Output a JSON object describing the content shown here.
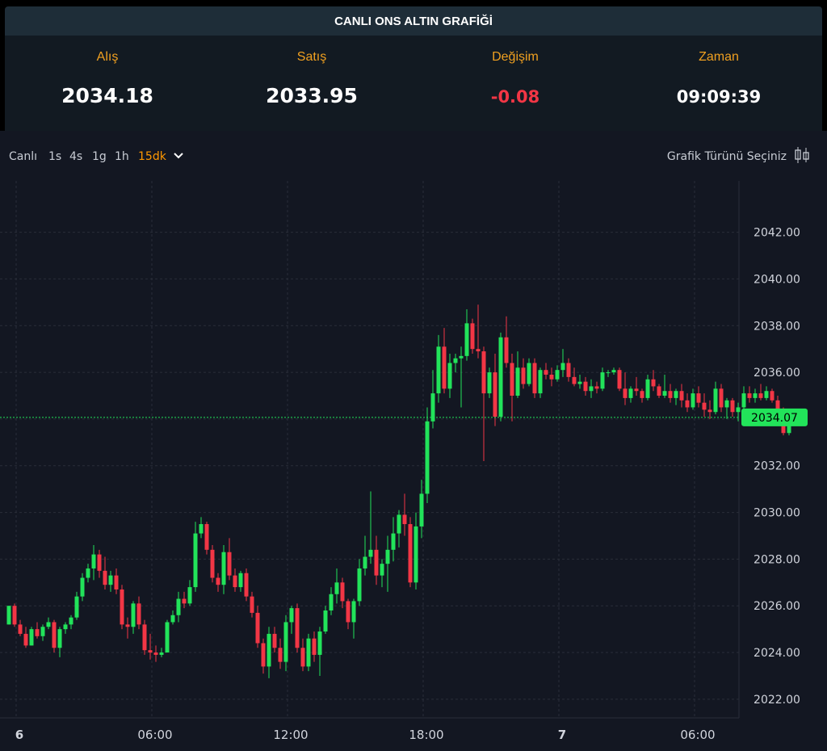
{
  "header": {
    "title": "CANLI ONS ALTIN GRAFİĞİ"
  },
  "quote": {
    "bid_label": "Alış",
    "bid_value": "2034.18",
    "ask_label": "Satış",
    "ask_value": "2033.95",
    "change_label": "Değişim",
    "change_value": "-0.08",
    "time_label": "Zaman",
    "time_value": "09:09:39"
  },
  "toolbar": {
    "timeframes": [
      "Canlı",
      "1s",
      "4s",
      "1g",
      "1h",
      "15dk"
    ],
    "active_timeframe": "15dk",
    "chart_type_label": "Grafik Türünü Seçiniz"
  },
  "colors": {
    "up": "#22e35a",
    "down": "#f23645",
    "accent": "#ff9800",
    "last_price": "#22e35a"
  },
  "chart_data": {
    "type": "candlestick",
    "title": "",
    "ylim": [
      2021.2,
      2044.2
    ],
    "y_ticks": [
      "2022.00",
      "2024.00",
      "2026.00",
      "2028.00",
      "2030.00",
      "2032.00",
      "2034.00",
      "2036.00",
      "2038.00",
      "2040.00",
      "2042.00"
    ],
    "x_ticks": [
      {
        "label": "6",
        "hour": 0
      },
      {
        "label": "06:00",
        "hour": 6
      },
      {
        "label": "12:00",
        "hour": 12
      },
      {
        "label": "18:00",
        "hour": 18
      },
      {
        "label": "7",
        "hour": 24
      },
      {
        "label": "06:00",
        "hour": 30
      }
    ],
    "grid": true,
    "last_price": "2034.07",
    "candles": [
      [
        2025.2,
        2026.0,
        2025.2,
        2026.0
      ],
      [
        2026.0,
        2026.1,
        2025.1,
        2025.2
      ],
      [
        2025.2,
        2025.4,
        2024.7,
        2024.8
      ],
      [
        2024.8,
        2025.1,
        2024.2,
        2024.3
      ],
      [
        2024.3,
        2025.1,
        2024.3,
        2025.0
      ],
      [
        2025.0,
        2025.3,
        2024.6,
        2024.7
      ],
      [
        2024.7,
        2025.2,
        2024.5,
        2025.1
      ],
      [
        2025.1,
        2025.5,
        2025.0,
        2025.3
      ],
      [
        2025.3,
        2025.4,
        2024.0,
        2024.2
      ],
      [
        2024.2,
        2025.1,
        2023.8,
        2025.0
      ],
      [
        2025.0,
        2025.3,
        2024.8,
        2025.2
      ],
      [
        2025.2,
        2025.6,
        2025.0,
        2025.5
      ],
      [
        2025.5,
        2026.6,
        2025.4,
        2026.4
      ],
      [
        2026.4,
        2027.4,
        2026.2,
        2027.2
      ],
      [
        2027.2,
        2027.8,
        2027.0,
        2027.6
      ],
      [
        2027.6,
        2028.6,
        2027.1,
        2028.2
      ],
      [
        2028.2,
        2028.4,
        2027.2,
        2027.5
      ],
      [
        2027.5,
        2028.1,
        2026.7,
        2026.9
      ],
      [
        2026.9,
        2027.5,
        2026.6,
        2027.3
      ],
      [
        2027.3,
        2027.6,
        2026.5,
        2026.7
      ],
      [
        2026.7,
        2026.9,
        2025.0,
        2025.2
      ],
      [
        2025.2,
        2025.5,
        2024.6,
        2025.1
      ],
      [
        2025.1,
        2026.2,
        2024.8,
        2026.1
      ],
      [
        2026.1,
        2026.4,
        2025.0,
        2025.2
      ],
      [
        2025.2,
        2025.4,
        2023.9,
        2024.1
      ],
      [
        2024.1,
        2024.8,
        2023.7,
        2024.0
      ],
      [
        2024.0,
        2024.3,
        2023.6,
        2023.9
      ],
      [
        2023.9,
        2024.2,
        2023.8,
        2024.0
      ],
      [
        2024.0,
        2025.4,
        2024.0,
        2025.3
      ],
      [
        2025.3,
        2025.8,
        2025.2,
        2025.6
      ],
      [
        2025.6,
        2026.6,
        2025.3,
        2026.3
      ],
      [
        2026.3,
        2026.6,
        2025.9,
        2026.1
      ],
      [
        2026.1,
        2027.1,
        2026.0,
        2026.8
      ],
      [
        2026.8,
        2029.6,
        2026.6,
        2029.1
      ],
      [
        2029.1,
        2029.8,
        2028.9,
        2029.5
      ],
      [
        2029.5,
        2029.6,
        2028.2,
        2028.4
      ],
      [
        2028.4,
        2028.6,
        2027.0,
        2027.2
      ],
      [
        2027.2,
        2027.4,
        2026.6,
        2026.9
      ],
      [
        2026.9,
        2028.6,
        2026.5,
        2028.3
      ],
      [
        2028.3,
        2028.9,
        2027.1,
        2027.3
      ],
      [
        2027.3,
        2027.6,
        2026.6,
        2026.8
      ],
      [
        2026.8,
        2027.5,
        2026.6,
        2027.4
      ],
      [
        2027.4,
        2027.6,
        2026.2,
        2026.4
      ],
      [
        2026.4,
        2026.6,
        2025.5,
        2025.7
      ],
      [
        2025.7,
        2026.0,
        2024.2,
        2024.4
      ],
      [
        2024.4,
        2024.6,
        2023.1,
        2023.4
      ],
      [
        2023.4,
        2025.1,
        2022.9,
        2024.8
      ],
      [
        2024.8,
        2025.1,
        2024.0,
        2024.2
      ],
      [
        2024.2,
        2024.6,
        2023.3,
        2023.6
      ],
      [
        2023.6,
        2025.6,
        2023.2,
        2025.3
      ],
      [
        2025.3,
        2026.0,
        2024.8,
        2025.9
      ],
      [
        2025.9,
        2026.1,
        2024.0,
        2024.2
      ],
      [
        2024.2,
        2024.6,
        2023.2,
        2023.4
      ],
      [
        2023.4,
        2024.8,
        2023.2,
        2024.6
      ],
      [
        2024.6,
        2024.9,
        2023.6,
        2023.9
      ],
      [
        2023.9,
        2025.1,
        2023.0,
        2024.9
      ],
      [
        2024.9,
        2026.0,
        2024.8,
        2025.8
      ],
      [
        2025.8,
        2026.8,
        2025.6,
        2026.5
      ],
      [
        2026.5,
        2027.6,
        2026.1,
        2027.0
      ],
      [
        2027.0,
        2027.2,
        2025.9,
        2026.2
      ],
      [
        2026.2,
        2026.3,
        2025.0,
        2025.3
      ],
      [
        2025.3,
        2026.3,
        2024.6,
        2026.2
      ],
      [
        2026.2,
        2028.0,
        2026.0,
        2027.6
      ],
      [
        2027.6,
        2029.0,
        2027.3,
        2028.1
      ],
      [
        2028.1,
        2030.9,
        2027.8,
        2028.4
      ],
      [
        2028.4,
        2029.0,
        2026.9,
        2027.3
      ],
      [
        2027.3,
        2028.0,
        2026.8,
        2027.8
      ],
      [
        2027.8,
        2029.0,
        2026.6,
        2028.4
      ],
      [
        2028.4,
        2029.8,
        2027.9,
        2029.1
      ],
      [
        2029.1,
        2030.1,
        2028.5,
        2029.9
      ],
      [
        2029.9,
        2030.8,
        2029.0,
        2029.5
      ],
      [
        2029.5,
        2029.8,
        2026.8,
        2027.0
      ],
      [
        2027.0,
        2030.0,
        2026.7,
        2029.4
      ],
      [
        2029.4,
        2031.4,
        2028.9,
        2030.8
      ],
      [
        2030.8,
        2034.5,
        2030.4,
        2033.9
      ],
      [
        2033.9,
        2036.1,
        2033.6,
        2035.1
      ],
      [
        2035.1,
        2037.6,
        2034.7,
        2037.1
      ],
      [
        2037.1,
        2037.9,
        2035.1,
        2035.3
      ],
      [
        2035.3,
        2036.8,
        2034.9,
        2036.4
      ],
      [
        2036.4,
        2036.8,
        2036.0,
        2036.6
      ],
      [
        2036.6,
        2037.1,
        2034.5,
        2036.7
      ],
      [
        2036.7,
        2038.7,
        2036.5,
        2038.1
      ],
      [
        2038.1,
        2038.3,
        2036.8,
        2037.0
      ],
      [
        2037.0,
        2038.9,
        2036.6,
        2036.9
      ],
      [
        2036.9,
        2037.1,
        2032.2,
        2035.1
      ],
      [
        2035.1,
        2036.2,
        2034.9,
        2036.0
      ],
      [
        2036.0,
        2036.8,
        2033.7,
        2034.1
      ],
      [
        2034.1,
        2037.7,
        2033.9,
        2037.5
      ],
      [
        2037.5,
        2038.4,
        2036.2,
        2036.4
      ],
      [
        2036.4,
        2036.8,
        2033.9,
        2035.0
      ],
      [
        2035.0,
        2036.9,
        2034.9,
        2036.2
      ],
      [
        2036.2,
        2036.6,
        2035.3,
        2035.5
      ],
      [
        2035.5,
        2036.6,
        2035.4,
        2036.4
      ],
      [
        2036.4,
        2036.6,
        2034.9,
        2035.1
      ],
      [
        2035.1,
        2036.2,
        2034.9,
        2036.1
      ],
      [
        2036.1,
        2036.4,
        2035.7,
        2035.9
      ],
      [
        2035.9,
        2036.2,
        2035.4,
        2035.7
      ],
      [
        2035.7,
        2036.3,
        2035.6,
        2036.1
      ],
      [
        2036.1,
        2037.0,
        2035.8,
        2036.4
      ],
      [
        2036.4,
        2036.6,
        2035.6,
        2035.8
      ],
      [
        2035.8,
        2036.2,
        2035.4,
        2035.5
      ],
      [
        2035.5,
        2035.9,
        2035.3,
        2035.6
      ],
      [
        2035.6,
        2035.8,
        2035.0,
        2035.2
      ],
      [
        2035.2,
        2035.7,
        2034.9,
        2035.4
      ],
      [
        2035.4,
        2035.6,
        2035.1,
        2035.3
      ],
      [
        2035.3,
        2036.2,
        2035.2,
        2036.0
      ],
      [
        2036.0,
        2036.1,
        2035.8,
        2036.0
      ],
      [
        2036.0,
        2036.2,
        2035.9,
        2036.1
      ],
      [
        2036.1,
        2036.2,
        2035.2,
        2035.3
      ],
      [
        2035.3,
        2036.0,
        2034.6,
        2034.9
      ],
      [
        2034.9,
        2035.4,
        2034.7,
        2035.3
      ],
      [
        2035.3,
        2035.8,
        2035.0,
        2035.2
      ],
      [
        2035.2,
        2035.3,
        2034.7,
        2034.9
      ],
      [
        2034.9,
        2035.9,
        2034.8,
        2035.7
      ],
      [
        2035.7,
        2036.1,
        2035.2,
        2035.4
      ],
      [
        2035.4,
        2035.5,
        2034.9,
        2035.0
      ],
      [
        2035.0,
        2035.9,
        2034.9,
        2035.2
      ],
      [
        2035.2,
        2035.5,
        2034.7,
        2034.9
      ],
      [
        2034.9,
        2035.3,
        2034.6,
        2035.2
      ],
      [
        2035.2,
        2035.5,
        2034.5,
        2034.8
      ],
      [
        2034.8,
        2035.1,
        2034.3,
        2034.5
      ],
      [
        2034.5,
        2035.3,
        2034.4,
        2035.1
      ],
      [
        2035.1,
        2035.4,
        2034.5,
        2034.7
      ],
      [
        2034.7,
        2035.1,
        2034.1,
        2034.4
      ],
      [
        2034.4,
        2034.8,
        2034.0,
        2034.3
      ],
      [
        2034.3,
        2035.6,
        2034.2,
        2035.3
      ],
      [
        2035.3,
        2035.5,
        2034.3,
        2034.5
      ],
      [
        2034.5,
        2034.9,
        2034.0,
        2034.8
      ],
      [
        2034.8,
        2034.9,
        2034.1,
        2034.3
      ],
      [
        2034.3,
        2034.7,
        2033.9,
        2034.5
      ],
      [
        2034.5,
        2035.4,
        2034.3,
        2035.1
      ],
      [
        2035.1,
        2035.4,
        2034.7,
        2034.9
      ],
      [
        2034.9,
        2035.3,
        2034.7,
        2035.1
      ],
      [
        2035.1,
        2035.5,
        2034.8,
        2034.9
      ],
      [
        2034.9,
        2035.4,
        2034.8,
        2035.2
      ],
      [
        2035.2,
        2035.3,
        2034.7,
        2034.8
      ],
      [
        2034.8,
        2035.0,
        2033.9,
        2034.1
      ],
      [
        2034.1,
        2034.5,
        2033.3,
        2033.4
      ],
      [
        2033.4,
        2034.3,
        2033.3,
        2034.1
      ]
    ]
  }
}
